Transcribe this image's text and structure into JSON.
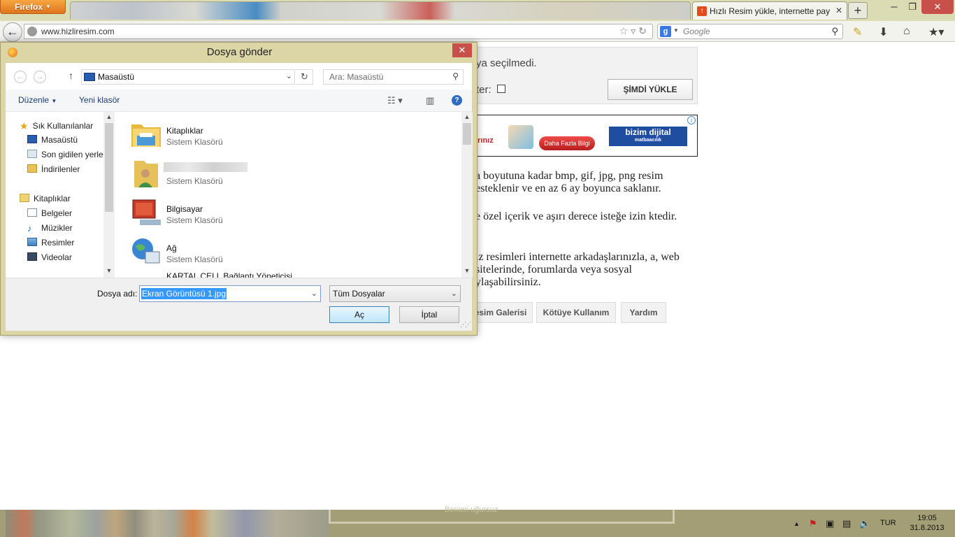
{
  "browser": {
    "menu_button": "Firefox",
    "active_tab_title": "Hızlı Resim yükle, internette pay...",
    "url": "www.hizliresim.com",
    "search_engine": "Google"
  },
  "page": {
    "upload_status": "ya seçilmedi.",
    "filter_label": "ter:",
    "upload_button": "ŞİMDİ YÜKLE",
    "ad_text": "arınız",
    "ad_button": "Daha Fazla Bilgi",
    "ad_brand": "bizim dijital",
    "ad_brand_sub": "matbaacılık",
    "paragraphs": [
      "a boyutuna kadar bmp, gif, jpg, png resim esteklenir ve en az 6 ay boyunca saklanır.",
      "e özel içerik ve aşırı derece isteğe izin ktedir.",
      "iz resimleri internette arkadaşlarınızla, a, web sitelerinde, forumlarda veya sosyal ylaşabilirsiniz."
    ],
    "bottom_tabs": [
      "esim Galerisi",
      "Kötüye Kullanım",
      "Yardım"
    ]
  },
  "dialog": {
    "title": "Dosya gönder",
    "address": "Masaüstü",
    "search_placeholder": "Ara: Masaüstü",
    "organize": "Düzenle",
    "new_folder": "Yeni klasör",
    "nav": {
      "favorites_header": "Sık Kullanılanlar",
      "favorites": [
        "Masaüstü",
        "Son gidilen yerler",
        "İndirilenler"
      ],
      "libraries_header": "Kitaplıklar",
      "libraries": [
        "Belgeler",
        "Müzikler",
        "Resimler",
        "Videolar"
      ]
    },
    "files": [
      {
        "name": "Kitaplıklar",
        "type": "Sistem Klasörü"
      },
      {
        "name": "",
        "type": "Sistem Klasörü"
      },
      {
        "name": "Bilgisayar",
        "type": "Sistem Klasörü"
      },
      {
        "name": "Ağ",
        "type": "Sistem Klasörü"
      },
      {
        "name": "KARTAL CELL Bağlantı Yöneticisi",
        "type": ""
      }
    ],
    "filename_label": "Dosya adı:",
    "filename_value": "Ekran Görüntüsü 1.jpg",
    "filetype": "Tüm Dosyalar",
    "open_button": "Aç",
    "cancel_button": "İptal"
  },
  "taskbar": {
    "ghost_text": "Benieri uğursuz",
    "language": "TUR",
    "time": "19:05",
    "date": "31.8.2013"
  }
}
